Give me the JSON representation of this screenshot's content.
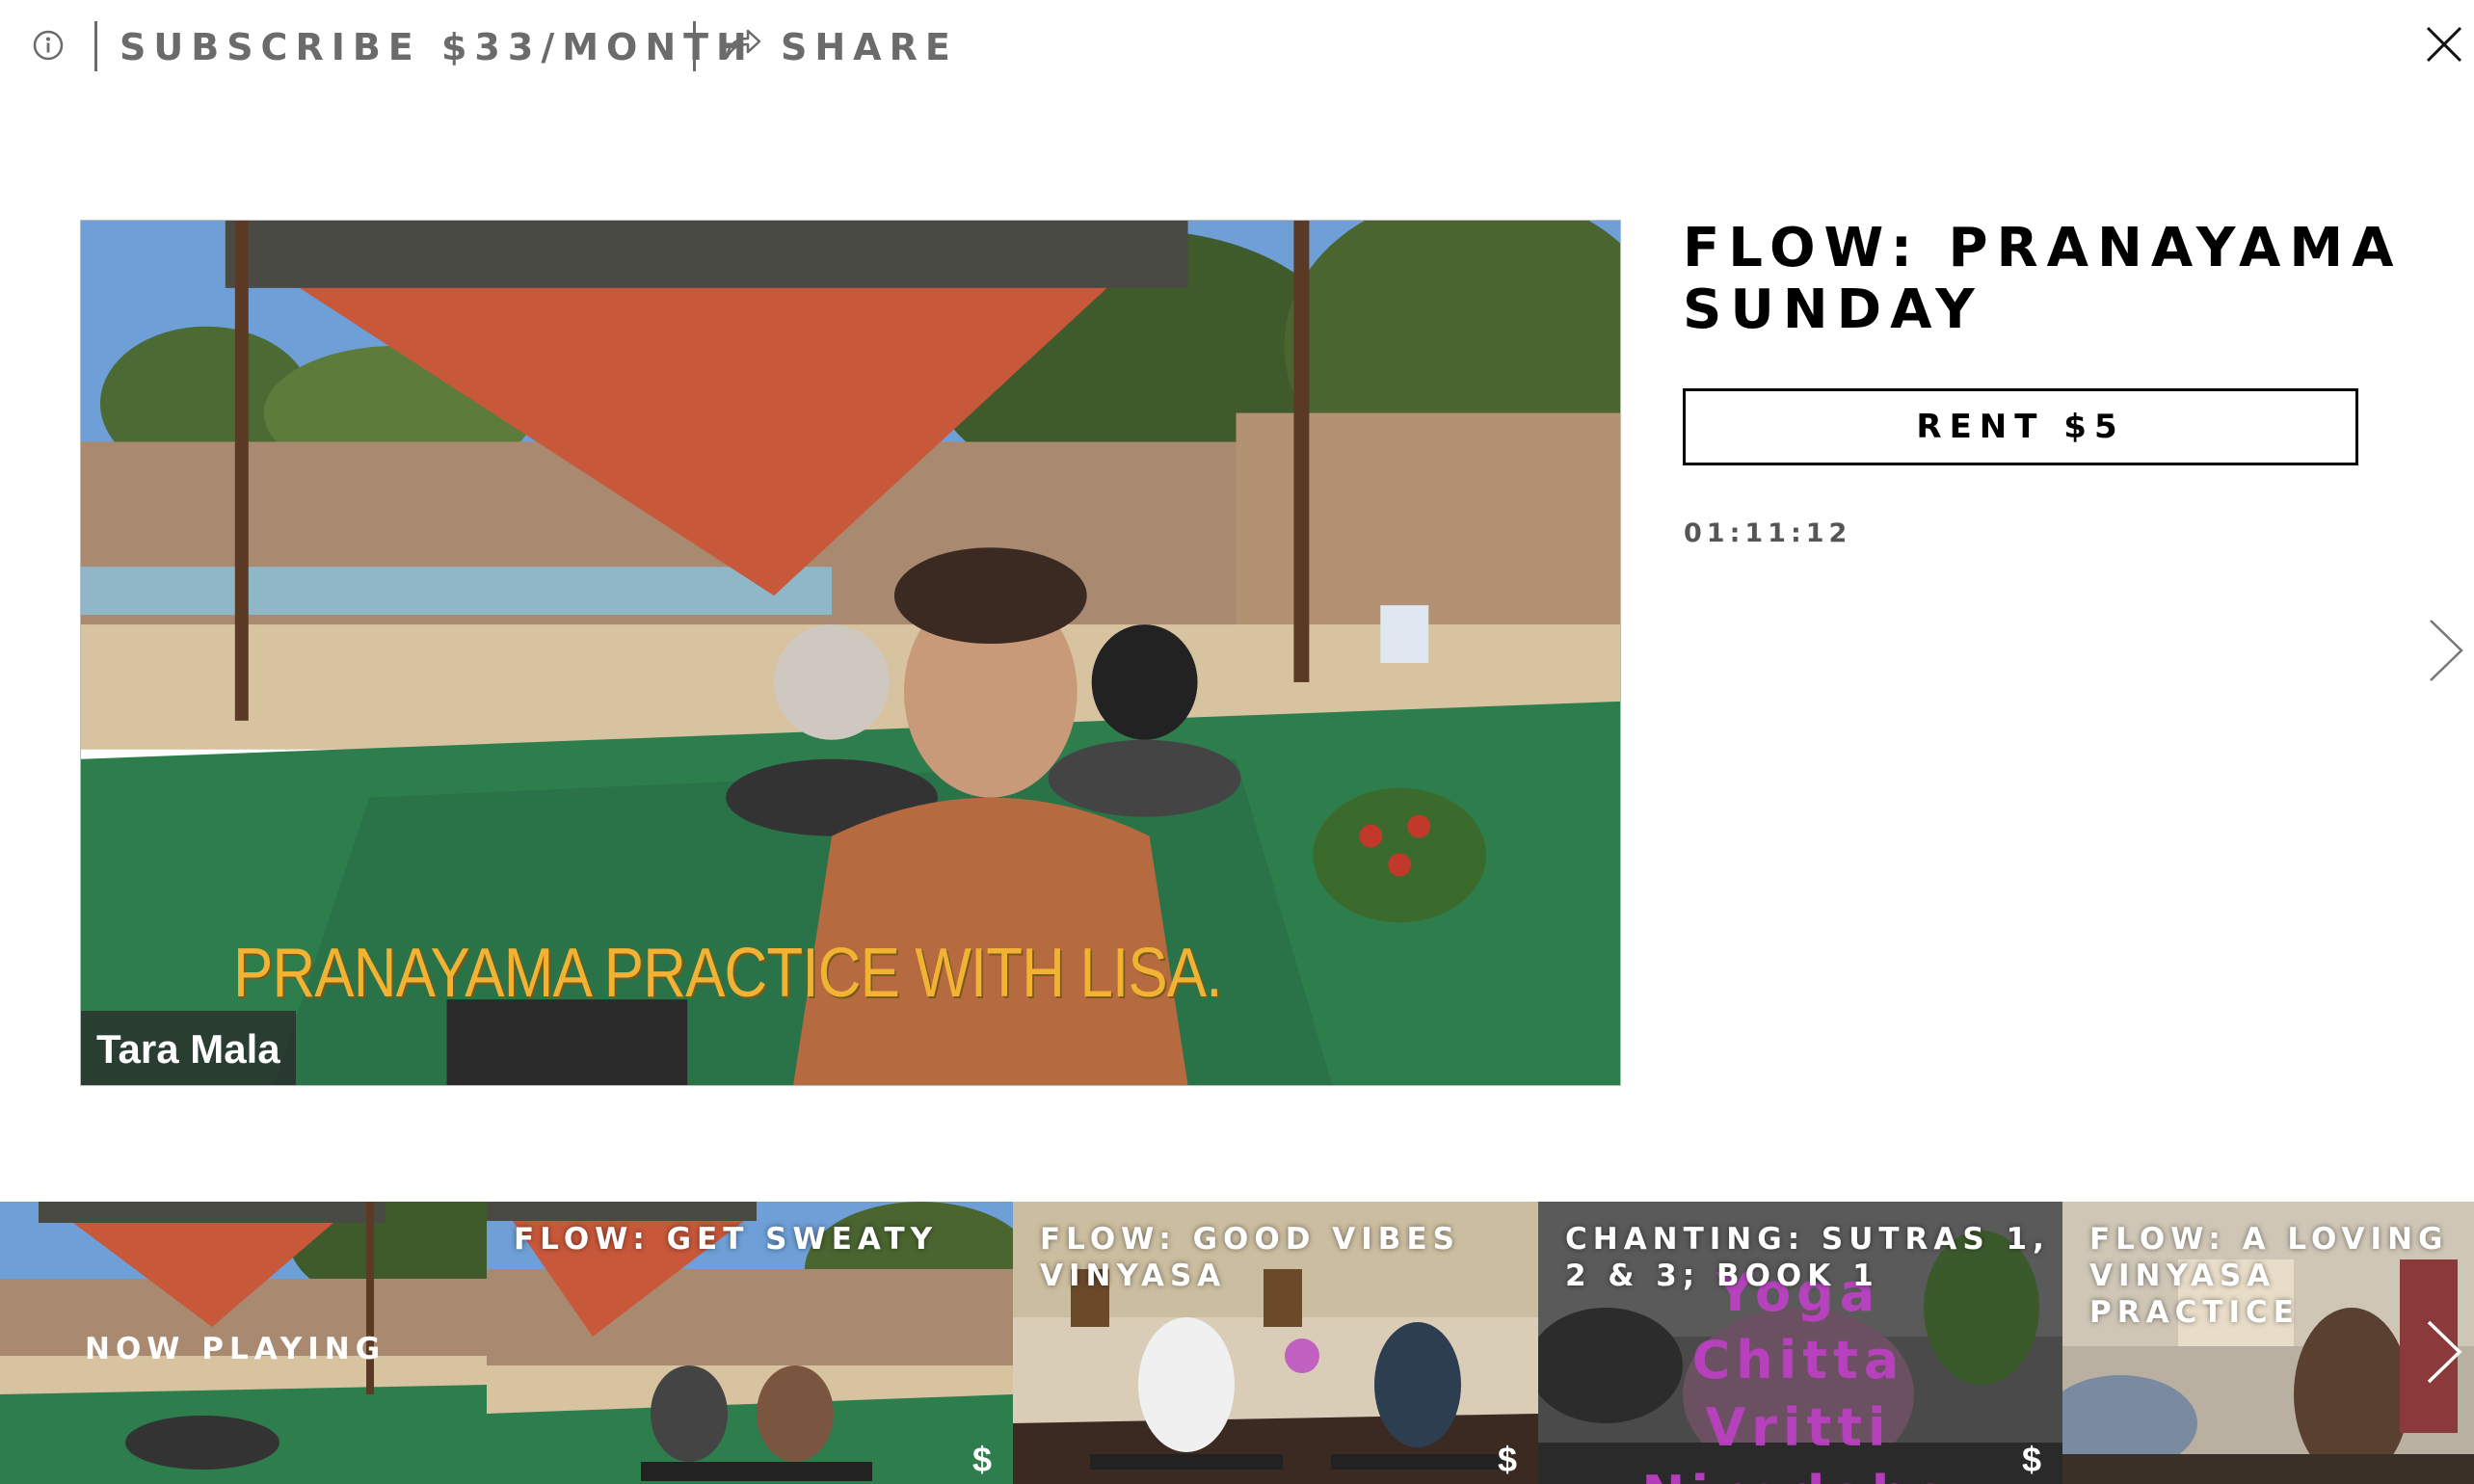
{
  "topbar": {
    "info_icon": "info-circle-icon",
    "subscribe_label": "SUBSCRIBE $33/MONTH",
    "share_icon": "share-arrow-icon",
    "share_label": "SHARE",
    "close_icon": "close-x-icon"
  },
  "player": {
    "caption": "PRANAYAMA PRACTICE WITH LISA.",
    "name_tag": "Tara Mala",
    "caption_color": "#f2b233"
  },
  "info": {
    "title": "FLOW: PRANAYAMA SUNDAY",
    "rent_label": "RENT $5",
    "duration": "01:11:12",
    "next_icon": "chevron-right-icon"
  },
  "carousel": {
    "now_playing_label": "NOW PLAYING",
    "items": [
      {
        "title": "",
        "price": ""
      },
      {
        "title": "FLOW: GET SWEATY",
        "price": "$"
      },
      {
        "title": "FLOW: GOOD VIBES VINYASA",
        "price": "$"
      },
      {
        "title": "CHANTING: SUTRAS 1, 2 & 3; BOOK 1",
        "price": "$",
        "overlay": "Yoga Chitta Vritti Nirodaha"
      },
      {
        "title": "FLOW: A LOVING VINYASA PRACTICE",
        "price": ""
      }
    ],
    "next_icon": "chevron-right-icon"
  }
}
